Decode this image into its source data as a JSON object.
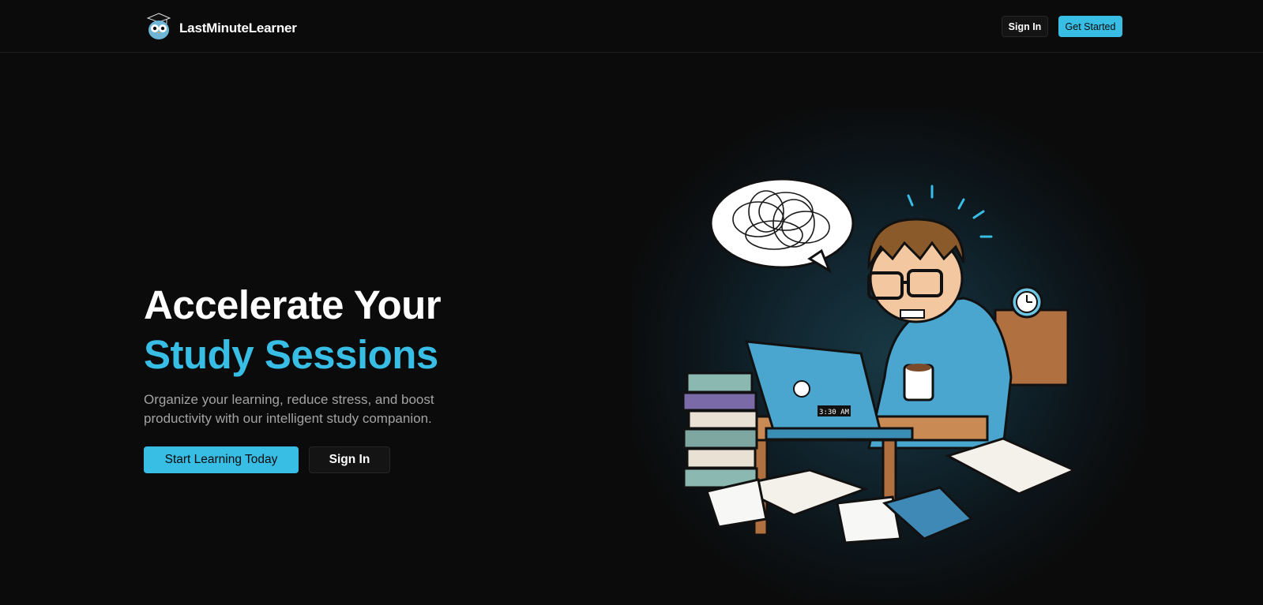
{
  "header": {
    "brand_name": "LastMinuteLearner",
    "logo_icon": "owl-graduation-cap-icon",
    "signin_label": "Sign In",
    "get_started_label": "Get Started"
  },
  "hero": {
    "title_line1": "Accelerate Your",
    "title_line2": "Study Sessions",
    "subtitle": "Organize your learning, reduce stress, and boost productivity with our intelligent study companion.",
    "primary_cta": "Start Learning Today",
    "secondary_cta": "Sign In"
  },
  "illustration": {
    "clock_text": "3:30 AM"
  },
  "colors": {
    "accent": "#38bde4",
    "background": "#0b0b0b"
  }
}
